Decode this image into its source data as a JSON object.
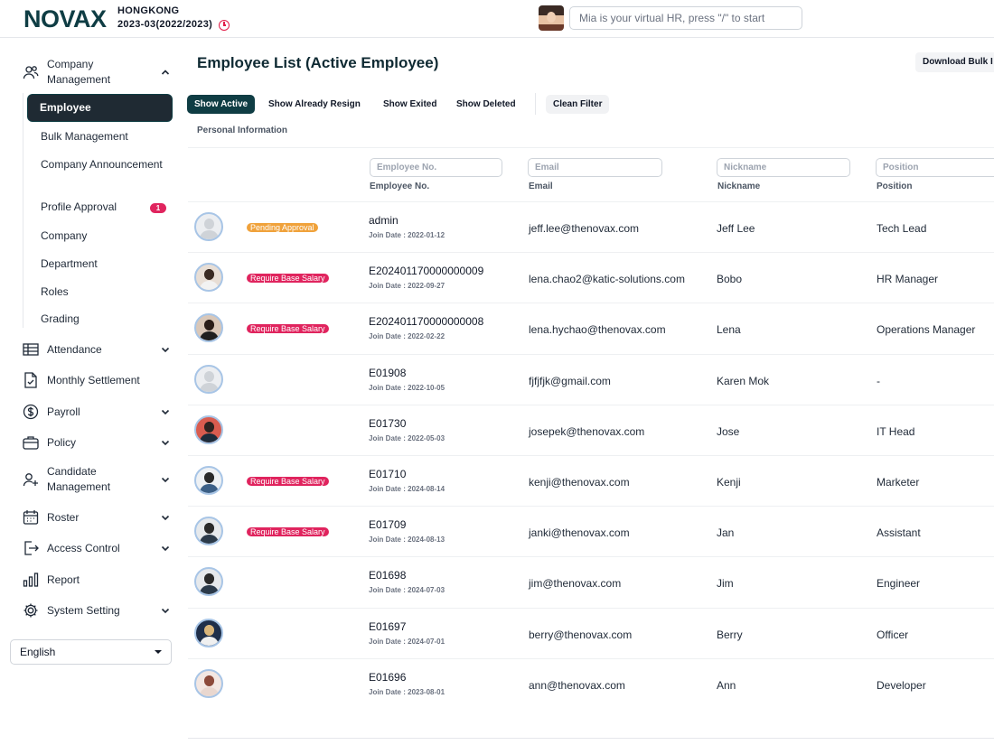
{
  "header": {
    "logo": "NOVAX",
    "company": "HONGKONG",
    "period": "2023-03(2022/2023)",
    "search_placeholder": "Mia is your virtual HR, press \"/\" to start"
  },
  "sidebar": {
    "company_management": {
      "label": "Company Management",
      "icon": "people-icon"
    },
    "sub_items": [
      {
        "label": "Employee",
        "active": true
      },
      {
        "label": "Bulk Management"
      },
      {
        "label": "Company Announcement"
      },
      {
        "label": "Profile Approval",
        "badge": "1"
      },
      {
        "label": "Company"
      },
      {
        "label": "Department"
      },
      {
        "label": "Roles"
      },
      {
        "label": "Grading"
      }
    ],
    "items": [
      {
        "label": "Attendance",
        "icon": "table-icon",
        "expandable": true
      },
      {
        "label": "Monthly Settlement",
        "icon": "document-check-icon",
        "expandable": false
      },
      {
        "label": "Payroll",
        "icon": "dollar-icon",
        "expandable": true
      },
      {
        "label": "Policy",
        "icon": "briefcase-icon",
        "expandable": true
      },
      {
        "label": "Candidate Management",
        "icon": "add-person-icon",
        "expandable": true
      },
      {
        "label": "Roster",
        "icon": "calendar-icon",
        "expandable": true
      },
      {
        "label": "Access Control",
        "icon": "door-exit-icon",
        "expandable": true
      },
      {
        "label": "Report",
        "icon": "bar-chart-icon",
        "expandable": false
      },
      {
        "label": "System Setting",
        "icon": "gear-icon",
        "expandable": true
      }
    ],
    "language": "English"
  },
  "main": {
    "title": "Employee List (Active Employee)",
    "download_label": "Download Bulk I",
    "filters": [
      {
        "label": "Show Active",
        "active": true
      },
      {
        "label": "Show Already Resign"
      },
      {
        "label": "Show Exited"
      },
      {
        "label": "Show Deleted"
      }
    ],
    "clean_filter": "Clean Filter",
    "section": "Personal Information",
    "columns": {
      "employee_no": {
        "placeholder": "Employee No.",
        "label": "Employee No."
      },
      "email": {
        "placeholder": "Email",
        "label": "Email"
      },
      "nickname": {
        "placeholder": "Nickname",
        "label": "Nickname"
      },
      "position": {
        "placeholder": "Position",
        "label": "Position"
      }
    },
    "rows": [
      {
        "emp_no": "admin",
        "join": "Join Date : 2022-01-12",
        "email": "jeff.lee@thenovax.com",
        "nickname": "Jeff Lee",
        "position": "Tech Lead",
        "badge": "Pending Approval",
        "badge_type": "pending",
        "photo": "placeholder"
      },
      {
        "emp_no": "E202401170000000009",
        "join": "Join Date : 2022-09-27",
        "email": "lena.chao2@katic-solutions.com",
        "nickname": "Bobo",
        "position": "HR Manager",
        "badge": "Require Base Salary",
        "badge_type": "salary",
        "photo": "woman"
      },
      {
        "emp_no": "E202401170000000008",
        "join": "Join Date : 2022-02-22",
        "email": "lena.hychao@thenovax.com",
        "nickname": "Lena",
        "position": "Operations Manager",
        "badge": "Require Base Salary",
        "badge_type": "salary",
        "photo": "woman-dark"
      },
      {
        "emp_no": "E01908",
        "join": "Join Date : 2022-10-05",
        "email": "fjfjfjk@gmail.com",
        "nickname": "Karen Mok",
        "position": "-",
        "badge": "",
        "badge_type": "",
        "photo": "placeholder"
      },
      {
        "emp_no": "E01730",
        "join": "Join Date : 2022-05-03",
        "email": "josepek@thenovax.com",
        "nickname": "Jose",
        "position": "IT Head",
        "badge": "",
        "badge_type": "",
        "photo": "man-red"
      },
      {
        "emp_no": "E01710",
        "join": "Join Date : 2024-08-14",
        "email": "kenji@thenovax.com",
        "nickname": "Kenji",
        "position": "Marketer",
        "badge": "Require Base Salary",
        "badge_type": "salary",
        "photo": "man-light"
      },
      {
        "emp_no": "E01709",
        "join": "Join Date : 2024-08-13",
        "email": "janki@thenovax.com",
        "nickname": "Jan",
        "position": "Assistant",
        "badge": "Require Base Salary",
        "badge_type": "salary",
        "photo": "man-suit"
      },
      {
        "emp_no": "E01698",
        "join": "Join Date : 2024-07-03",
        "email": "jim@thenovax.com",
        "nickname": "Jim",
        "position": "Engineer",
        "badge": "",
        "badge_type": "",
        "photo": "man-suit"
      },
      {
        "emp_no": "E01697",
        "join": "Join Date : 2024-07-01",
        "email": "berry@thenovax.com",
        "nickname": "Berry",
        "position": "Officer",
        "badge": "",
        "badge_type": "",
        "photo": "woman-blonde"
      },
      {
        "emp_no": "E01696",
        "join": "Join Date : 2023-08-01",
        "email": "ann@thenovax.com",
        "nickname": "Ann",
        "position": "Developer",
        "badge": "",
        "badge_type": "",
        "photo": "woman-red"
      }
    ]
  },
  "colors": {
    "brand": "#0f3d44",
    "badge_pending": "#f0a23b",
    "badge_salary": "#e0245e"
  }
}
